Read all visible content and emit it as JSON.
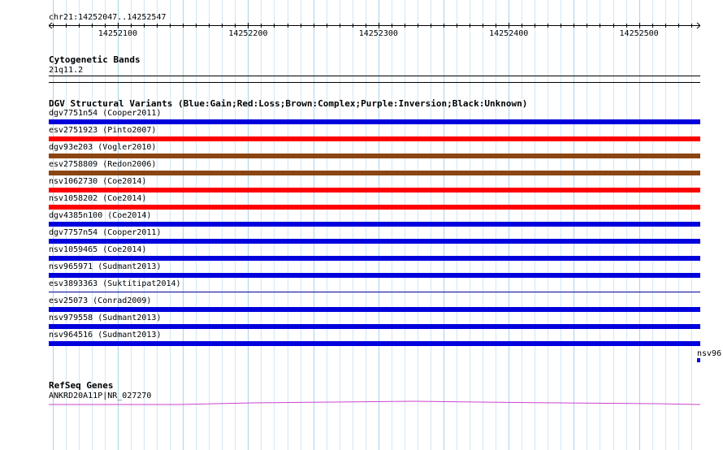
{
  "ruler": {
    "location": "chr21:14252047..14252547",
    "start": 14252047,
    "end": 14252547,
    "ticks": [
      "14252100",
      "14252200",
      "14252300",
      "14252400",
      "14252500"
    ]
  },
  "cytoband": {
    "title": "Cytogenetic Bands",
    "band": "21q11.2"
  },
  "dgv": {
    "title": "DGV Structural Variants (Blue:Gain;Red:Loss;Brown:Complex;Purple:Inversion;Black:Unknown)",
    "colors": {
      "gain": "#0000dd",
      "loss": "#ff0000",
      "complex": "#8b4513",
      "thin": "#000099"
    },
    "features": [
      {
        "label": "dgv7751n54 (Cooper2011)",
        "type": "gain"
      },
      {
        "label": "esv2751923 (Pinto2007)",
        "type": "loss"
      },
      {
        "label": "dgv93e203 (Vogler2010)",
        "type": "complex"
      },
      {
        "label": "esv2758809 (Redon2006)",
        "type": "complex"
      },
      {
        "label": "nsv1062730 (Coe2014)",
        "type": "loss"
      },
      {
        "label": "nsv1058202 (Coe2014)",
        "type": "loss"
      },
      {
        "label": "dgv4385n100 (Coe2014)",
        "type": "gain"
      },
      {
        "label": "dgv7757n54 (Cooper2011)",
        "type": "gain"
      },
      {
        "label": "nsv1059465 (Coe2014)",
        "type": "gain"
      },
      {
        "label": "nsv965971 (Sudmant2013)",
        "type": "gain"
      },
      {
        "label": "esv3893363 (Suktitipat2014)",
        "type": "thin"
      },
      {
        "label": "esv25073 (Conrad2009)",
        "type": "gain"
      },
      {
        "label": "nsv979558 (Sudmant2013)",
        "type": "gain"
      },
      {
        "label": "nsv964516 (Sudmant2013)",
        "type": "gain"
      }
    ],
    "overflow_label": "nsv96"
  },
  "refseq": {
    "title": "RefSeq Genes",
    "gene": "ANKRD20A11P|NR_027270",
    "color": "#cc44cc"
  }
}
